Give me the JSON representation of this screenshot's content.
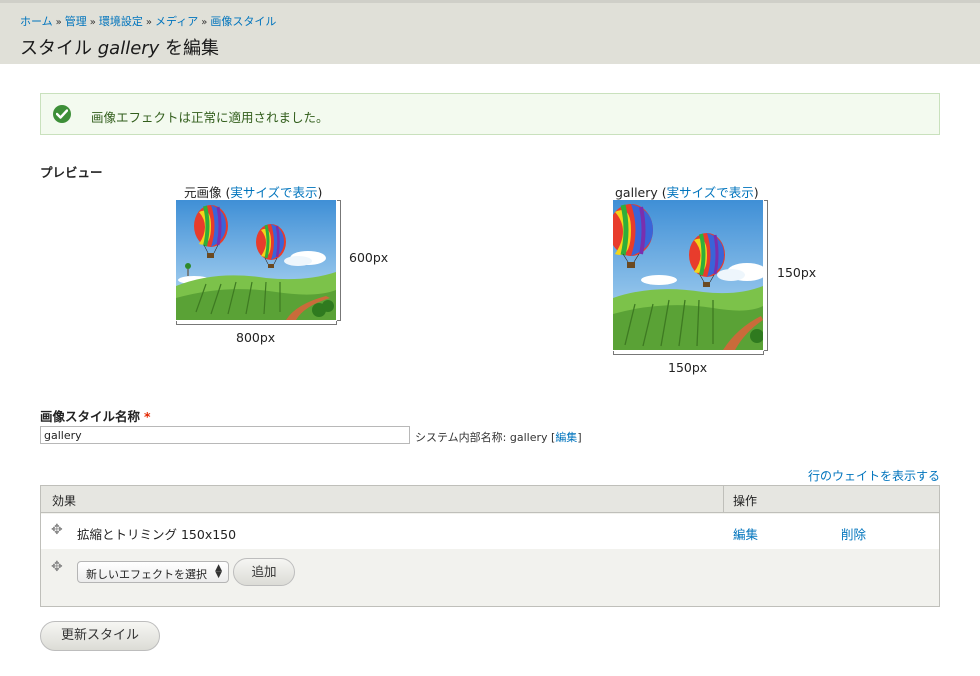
{
  "breadcrumb": [
    "ホーム",
    "管理",
    "環境設定",
    "メディア",
    "画像スタイル"
  ],
  "breadcrumb_separator": "»",
  "title": {
    "prefix": "スタイル ",
    "style_name": "gallery",
    "suffix": " を編集"
  },
  "message": "画像エフェクトは正常に適用されました。",
  "preview": {
    "label": "プレビュー",
    "original": {
      "caption": "元画像",
      "link": "実サイズで表示",
      "width_label": "800px",
      "height_label": "600px"
    },
    "derivative": {
      "caption": "gallery",
      "link": "実サイズで表示",
      "width_label": "150px",
      "height_label": "150px"
    }
  },
  "name_field": {
    "label": "画像スタイル名称",
    "required_mark": "*",
    "value": "gallery",
    "machine_name_label": "システム内部名称: gallery",
    "edit_link": "編集"
  },
  "show_weights_link": "行のウェイトを表示する",
  "table": {
    "headers": [
      "効果",
      "操作"
    ],
    "rows": [
      {
        "effect": "拡縮とトリミング 150x150",
        "edit": "編集",
        "delete": "削除"
      }
    ],
    "new_effect_select": "新しいエフェクトを選択",
    "add_button": "追加"
  },
  "save_button": "更新スタイル",
  "colors": {
    "link": "#0074bd",
    "header_bg": "#e0e0d8",
    "message_bg": "#f3faef",
    "message_border": "#c9e1bd",
    "required": "#e32700"
  }
}
